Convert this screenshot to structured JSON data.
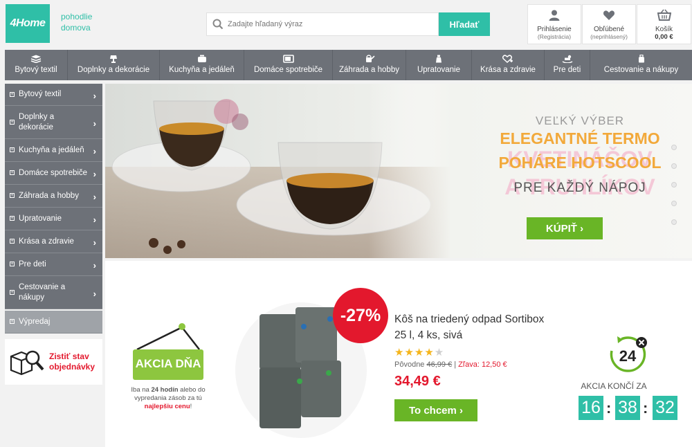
{
  "header": {
    "logo": "4Home",
    "slogan_line1": "pohodlie",
    "slogan_line2": "domova",
    "search_placeholder": "Zadajte hľadaný výraz",
    "search_button": "Hľadať",
    "login_label": "Prihlásenie",
    "login_sub": "(Registrácia)",
    "favorites_label": "Obľúbené",
    "favorites_sub": "(neprihlásený)",
    "cart_label": "Košík",
    "cart_total": "0,00 €"
  },
  "topnav": [
    {
      "label": "Bytový textil",
      "icon": "textile-icon"
    },
    {
      "label": "Doplnky a dekorácie",
      "icon": "lamp-icon"
    },
    {
      "label": "Kuchyňa a jedáleň",
      "icon": "pot-icon"
    },
    {
      "label": "Domáce spotrebiče",
      "icon": "microwave-icon"
    },
    {
      "label": "Záhrada a hobby",
      "icon": "watering-can-icon"
    },
    {
      "label": "Upratovanie",
      "icon": "spray-bottle-icon"
    },
    {
      "label": "Krása a zdravie",
      "icon": "heart-plus-icon"
    },
    {
      "label": "Pre deti",
      "icon": "rocking-horse-icon"
    },
    {
      "label": "Cestovanie a nákupy",
      "icon": "bag-icon"
    }
  ],
  "sidebar": {
    "items": [
      {
        "label": "Bytový textil"
      },
      {
        "label": "Doplnky a dekorácie"
      },
      {
        "label": "Kuchyňa a jedáleň"
      },
      {
        "label": "Domáce spotrebiče"
      },
      {
        "label": "Záhrada a hobby"
      },
      {
        "label": "Upratovanie"
      },
      {
        "label": "Krása a zdravie"
      },
      {
        "label": "Pre deti"
      },
      {
        "label": "Cestovanie a nákupy"
      }
    ],
    "sale": "Výpredaj",
    "order_status_line1": "Zistiť stav",
    "order_status_line2": "objednávky"
  },
  "banner": {
    "line1": "VEĽKÝ VÝBER",
    "line2": "ELEGANTNÉ TERMO",
    "line3": "POHÁRE HOTSCOOL",
    "line4": "PRE KAŽDÝ NÁPOJ",
    "ghost1": "KVETINÁČOV",
    "ghost2": "A TRUHLÍKOV",
    "buy_button": "KÚPIŤ",
    "slides_count": 5
  },
  "deal": {
    "badge": "AKCIA DŇA",
    "note_part1": "Iba na ",
    "note_bold": "24 hodín",
    "note_part2": " alebo do vypredania zásob za tú ",
    "note_red": "najlepšiu cenu",
    "note_end": "!",
    "discount": "-27%",
    "title_line1": "Kôš na triedený odpad Sortibox",
    "title_line2": "25 l, 4 ks, sivá",
    "rating": 4.5,
    "original_label": "Pôvodne ",
    "original_price": "46,99 €",
    "separator": " | ",
    "savings": "Zľava: 12,50 €",
    "price": "34,49 €",
    "cta": "To chcem",
    "timer_badge": "24",
    "ends_label": "AKCIA KONČÍ ZA",
    "hours": "16",
    "minutes": "38",
    "seconds": "32",
    "colon": ":"
  },
  "colors": {
    "teal": "#2fbfa7",
    "nav_gray": "#6d7178",
    "green": "#69b526",
    "red": "#e3182d",
    "banner_orange": "#f2a93b",
    "banner_pink": "#f4c1d3"
  }
}
